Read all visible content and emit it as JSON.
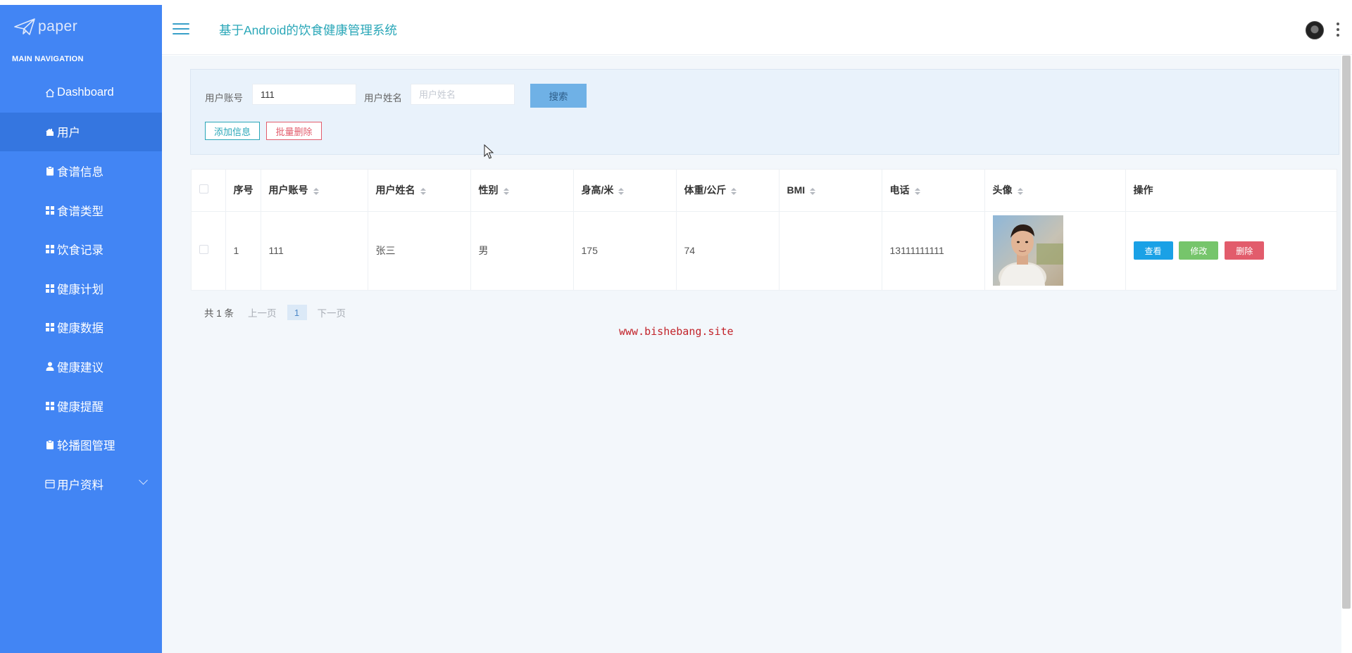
{
  "sidebar": {
    "brand": "paper",
    "caption": "MAIN NAVIGATION",
    "items": [
      {
        "label": "Dashboard",
        "icon": "home-icon"
      },
      {
        "label": "用户",
        "icon": "user-home-icon",
        "active": true
      },
      {
        "label": "食谱信息",
        "icon": "clipboard-icon"
      },
      {
        "label": "食谱类型",
        "icon": "grid-icon"
      },
      {
        "label": "饮食记录",
        "icon": "grid-icon"
      },
      {
        "label": "健康计划",
        "icon": "grid-icon"
      },
      {
        "label": "健康数据",
        "icon": "grid-icon"
      },
      {
        "label": "健康建议",
        "icon": "person-icon"
      },
      {
        "label": "健康提醒",
        "icon": "grid-icon"
      },
      {
        "label": "轮播图管理",
        "icon": "clipboard-icon"
      },
      {
        "label": "用户资料",
        "icon": "calendar-icon",
        "expandable": true
      }
    ]
  },
  "header": {
    "title": "基于Android的饮食健康管理系统"
  },
  "search": {
    "account_label": "用户账号",
    "account_value": "111",
    "name_label": "用户姓名",
    "name_placeholder": "用户姓名",
    "search_button": "搜索",
    "add_button": "添加信息",
    "batch_delete_button": "批量删除"
  },
  "table": {
    "columns": [
      "序号",
      "用户账号",
      "用户姓名",
      "性别",
      "身高/米",
      "体重/公斤",
      "BMI",
      "电话",
      "头像",
      "操作"
    ],
    "rows": [
      {
        "index": "1",
        "account": "111",
        "name": "张三",
        "gender": "男",
        "height": "175",
        "weight": "74",
        "bmi": "",
        "phone": "13111111111"
      }
    ],
    "actions": {
      "view": "查看",
      "edit": "修改",
      "delete": "删除"
    }
  },
  "pagination": {
    "total": "共 1 条",
    "prev": "上一页",
    "current": "1",
    "next": "下一页"
  },
  "watermark": "www.bishebang.site",
  "colors": {
    "sidebar": "#4285f4",
    "accent": "#2aa7b8",
    "danger": "#e25c6c",
    "view": "#1aa1e6",
    "edit": "#76c56b"
  }
}
